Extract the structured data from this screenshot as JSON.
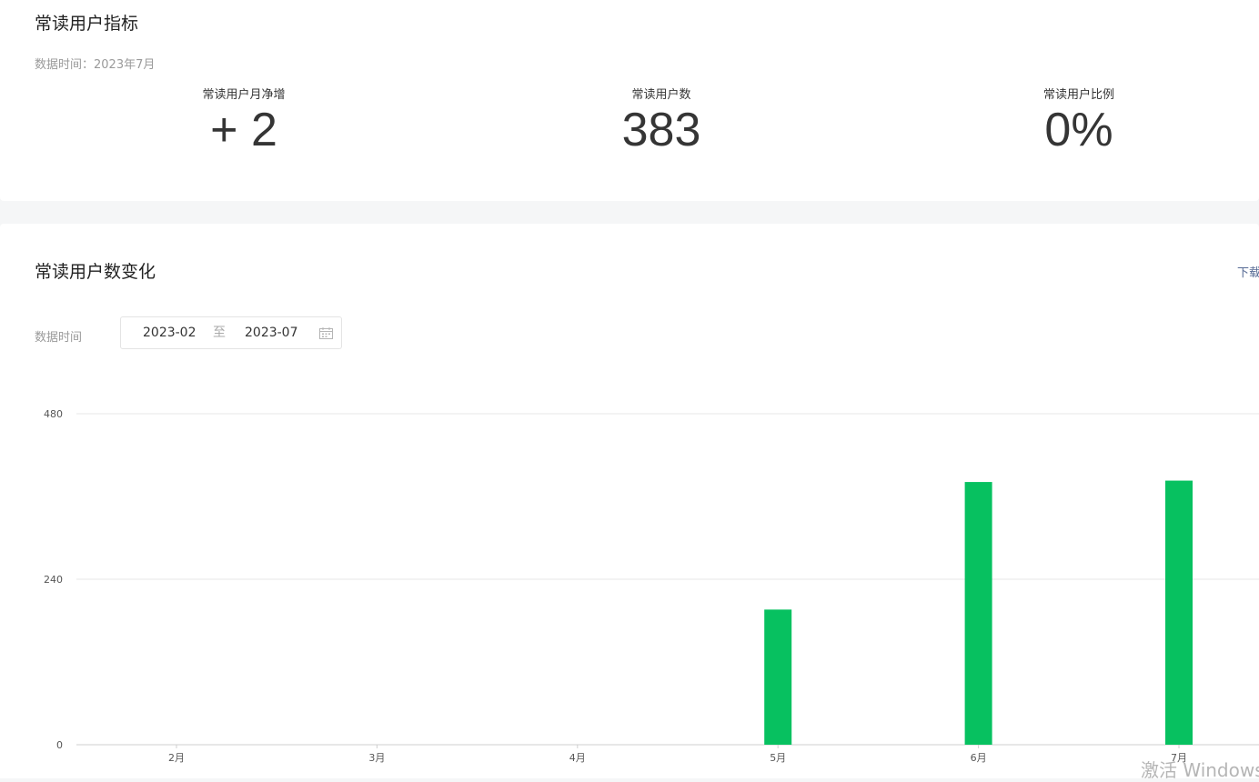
{
  "metrics_card": {
    "title": "常读用户指标",
    "data_time": "数据时间：2023年7月",
    "metrics": [
      {
        "label": "常读用户月净增",
        "value": "+ 2"
      },
      {
        "label": "常读用户数",
        "value": "383"
      },
      {
        "label": "常读用户比例",
        "value": "0%"
      }
    ]
  },
  "trend_card": {
    "title": "常读用户数变化",
    "download_label": "下载",
    "date_filter": {
      "label": "数据时间",
      "start": "2023-02",
      "separator": "至",
      "end": "2023-07",
      "icon": "calendar-icon"
    }
  },
  "colors": {
    "bar": "#07c160",
    "link": "#576b95",
    "grid": "#e7e7e7"
  },
  "chart_data": {
    "type": "bar",
    "categories": [
      "2月",
      "3月",
      "4月",
      "5月",
      "6月",
      "7月"
    ],
    "values": [
      0,
      0,
      0,
      196,
      381,
      383
    ],
    "y_ticks": [
      "0",
      "240",
      "480"
    ],
    "ylim": [
      0,
      480
    ],
    "grid": true,
    "title": "",
    "xlabel": "",
    "ylabel": ""
  },
  "watermark": "激活 Windows"
}
